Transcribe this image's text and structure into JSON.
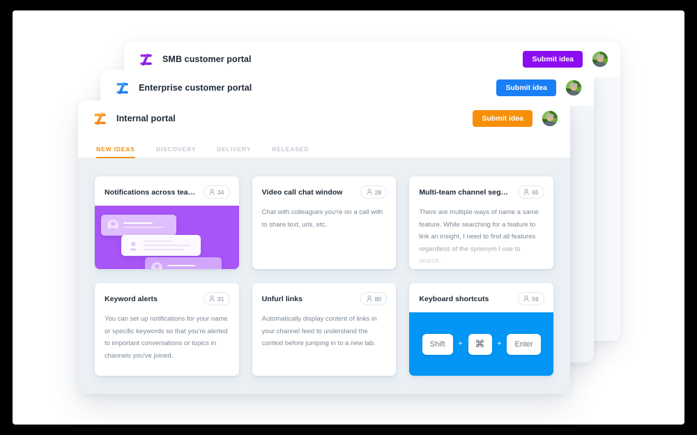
{
  "windows": [
    {
      "id": "smb",
      "title": "SMB customer portal",
      "submit_label": "Submit idea",
      "accent": "#8b0ef0",
      "logo_from": "#b936f5",
      "logo_to": "#6d0fd6"
    },
    {
      "id": "enterprise",
      "title": "Enterprise customer portal",
      "submit_label": "Submit idea",
      "accent": "#1a7ff5",
      "logo_from": "#56b8ff",
      "logo_to": "#0a5fe0"
    },
    {
      "id": "internal",
      "title": "Internal portal",
      "submit_label": "Submit idea",
      "accent": "#f79009",
      "logo_from": "#ffc043",
      "logo_to": "#f2680a"
    }
  ],
  "tabs": [
    {
      "label": "NEW IDEAS",
      "active": true
    },
    {
      "label": "DISCOVERY",
      "active": false
    },
    {
      "label": "DELIVERY",
      "active": false
    },
    {
      "label": "RELEASED",
      "active": false
    }
  ],
  "cards": [
    {
      "title": "Notifications across teams",
      "votes": "34",
      "body": "",
      "media": "purple-notifications"
    },
    {
      "title": "Video call chat window",
      "votes": "28",
      "body": "Chat with colleagues you're on a call with to share text, urls, etc.",
      "media": "none"
    },
    {
      "title": "Multi-team channel segments",
      "votes": "65",
      "body": "There are multiple ways of name a same feature. While searching for a feature to link an insight, I need to find all features regardless of the synonym I use to search.",
      "media": "none"
    },
    {
      "title": "Keyword alerts",
      "votes": "31",
      "body": "You can set up notifications for your name or specific keywords so that you're alerted to important conversations or topics in channels you've joined.",
      "media": "none"
    },
    {
      "title": "Unfurl links",
      "votes": "80",
      "body": "Automatically display content of links in your channel feed to understand the context before jumping in to a new tab.",
      "media": "none"
    },
    {
      "title": "Keyboard shortcuts",
      "votes": "59",
      "body": "",
      "media": "blue-keys"
    }
  ],
  "keyboard": {
    "keys": [
      "Shift",
      "⌘",
      "Enter"
    ],
    "separator": "+"
  },
  "colors": {
    "board_background": "#eaf0f4",
    "purple_media": "#a855f7",
    "blue_media": "#0496f5",
    "tab_active": "#f79009",
    "text_primary": "#1b2733",
    "text_muted": "#7b8894"
  }
}
